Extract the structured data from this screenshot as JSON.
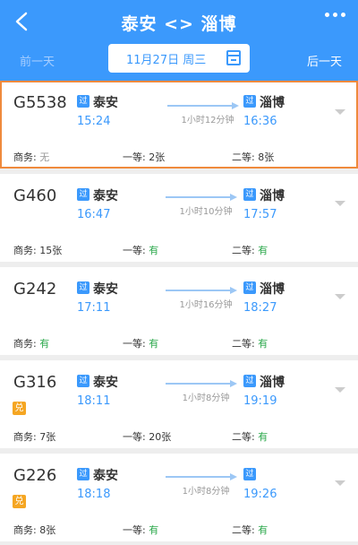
{
  "header": {
    "title": "泰安 <> 淄博",
    "prev_day": "前一天",
    "next_day": "后一天",
    "date": "11月27日 周三"
  },
  "trains": [
    {
      "code": "G5538",
      "badge": "",
      "from_tag": "过",
      "from": "泰安",
      "dep": "15:24",
      "duration": "1小时12分钟",
      "to_tag": "过",
      "to": "淄博",
      "arr": "16:36",
      "business": "商务: ",
      "business_v": "无",
      "first": "一等: ",
      "first_v": "2张",
      "second": "二等: ",
      "second_v": "8张"
    },
    {
      "code": "G460",
      "badge": "",
      "from_tag": "过",
      "from": "泰安",
      "dep": "16:47",
      "duration": "1小时10分钟",
      "to_tag": "过",
      "to": "淄博",
      "arr": "17:57",
      "business": "商务: ",
      "business_v": "15张",
      "first": "一等: ",
      "first_v": "有",
      "second": "二等: ",
      "second_v": "有"
    },
    {
      "code": "G242",
      "badge": "",
      "from_tag": "过",
      "from": "泰安",
      "dep": "17:11",
      "duration": "1小时16分钟",
      "to_tag": "过",
      "to": "淄博",
      "arr": "18:27",
      "business": "商务: ",
      "business_v": "有",
      "first": "一等: ",
      "first_v": "有",
      "second": "二等: ",
      "second_v": "有"
    },
    {
      "code": "G316",
      "badge": "兑",
      "from_tag": "过",
      "from": "泰安",
      "dep": "18:11",
      "duration": "1小时8分钟",
      "to_tag": "过",
      "to": "淄博",
      "arr": "19:19",
      "business": "商务: ",
      "business_v": "7张",
      "first": "一等: ",
      "first_v": "20张",
      "second": "二等: ",
      "second_v": "有"
    },
    {
      "code": "G226",
      "badge": "兑",
      "from_tag": "过",
      "from": "泰安",
      "dep": "18:18",
      "duration": "1小时8分钟",
      "to_tag": "过",
      "to": "",
      "arr": "19:26",
      "business": "商务: ",
      "business_v": "8张",
      "first": "一等: ",
      "first_v": "有",
      "second": "二等: ",
      "second_v": "有"
    }
  ],
  "colors": {
    "header_bg": "#3b99fc",
    "time": "#3b99fc",
    "available": "#2aa84a",
    "selected_border": "#ef8a3c",
    "badge": "#f5a623"
  }
}
